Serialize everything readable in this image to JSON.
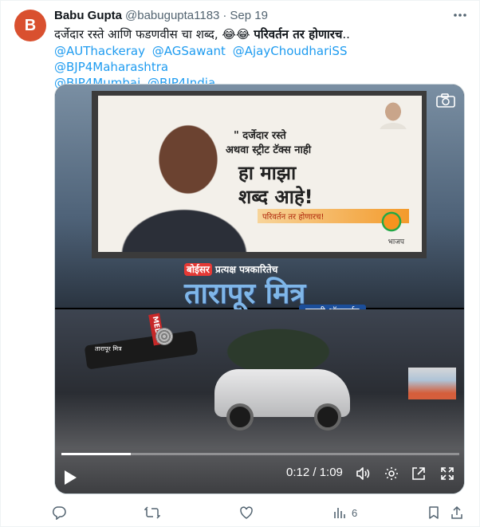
{
  "author": {
    "avatar_letter": "B",
    "name": "Babu Gupta",
    "handle": "@babugupta1183",
    "separator": "·",
    "date": "Sep 19",
    "avatar_color": "#d9502f"
  },
  "tweet": {
    "text_main": "दर्जेदार रस्ते आणि फडणवीस चा शब्द, ",
    "emoji": "😂😂 ",
    "text_bold": "परिवर्तन तर होणारच",
    "text_end": "..",
    "mentions": [
      "@AUThackeray",
      "@AGSawant",
      "@AjayChoudhariSS",
      "@BJP4Maharashtra",
      "@BJP4Mumbai",
      "@BJP4India"
    ],
    "link_color": "#1d9bf0"
  },
  "video": {
    "billboard": {
      "line1": "\" दर्जेदार रस्ते",
      "line2": "अथवा स्ट्रीट टॅक्स नाही",
      "line3": "हा माझा",
      "line4": "शब्द आहे!",
      "strip": "परिवर्तन तर होणारच!",
      "party": "भाजप"
    },
    "watermark": {
      "badge": "बोईसर",
      "tagline": " प्रत्यक्ष पत्रकारितेच",
      "title": "तारापूर मित्र",
      "subtitle": "बातमी ऑनलाईन"
    },
    "sticker": {
      "media": "MEDIA",
      "text": "तारापूर मित्र"
    },
    "controls": {
      "time": "0:12 / 1:09",
      "progress": 0.174
    }
  },
  "actions": {
    "reply": "",
    "retweet": "",
    "like": "",
    "views": "6"
  }
}
